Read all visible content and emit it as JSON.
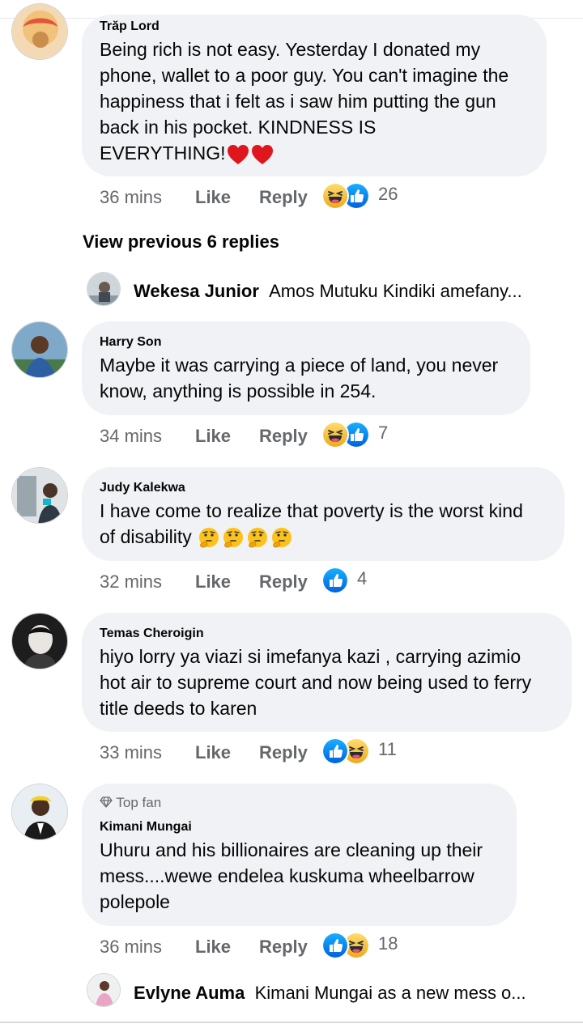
{
  "comments": [
    {
      "author": "Trăp Lord",
      "text": "Being rich is not easy. Yesterday I donated my\nphone, wallet to a poor guy. You can't imagine the\nhappiness that i felt as i saw him putting the gun\nback in his pocket. KINDNESS IS\nEVERYTHING!",
      "trailing_emoji": "❤❤",
      "time": "36 mins",
      "like_label": "Like",
      "reply_label": "Reply",
      "reactions": [
        "haha",
        "like"
      ],
      "reaction_count": "26"
    },
    {
      "author": "Harry Son",
      "text": "Maybe it was carrying a piece of land, you never\nknow, anything is possible in 254.",
      "time": "34 mins",
      "like_label": "Like",
      "reply_label": "Reply",
      "reactions": [
        "haha",
        "like"
      ],
      "reaction_count": "7"
    },
    {
      "author": "Judy Kalekwa",
      "text": "I have come to realize that poverty is the worst kind\nof disability",
      "trailing_emoji": "🤔🤔🤔🤔",
      "time": "32 mins",
      "like_label": "Like",
      "reply_label": "Reply",
      "reactions": [
        "like"
      ],
      "reaction_count": "4"
    },
    {
      "author": "Temas Cheroigin",
      "text": "hiyo lorry ya viazi si imefanya kazi , carrying azimio\nhot air to supreme court and now being used to ferry\ntitle deeds to karen",
      "time": "33 mins",
      "like_label": "Like",
      "reply_label": "Reply",
      "reactions": [
        "like",
        "haha"
      ],
      "reaction_count": "11"
    },
    {
      "badge": "Top fan",
      "author": "Kimani Mungai",
      "text": "Uhuru and his billionaires are cleaning up their\nmess....wewe endelea kuskuma wheelbarrow\npolepole",
      "time": "36 mins",
      "like_label": "Like",
      "reply_label": "Reply",
      "reactions": [
        "like",
        "haha"
      ],
      "reaction_count": "18"
    }
  ],
  "view_previous": "View previous 6 replies",
  "reply_previews": [
    {
      "author": "Wekesa Junior",
      "snippet": "Amos Mutuku Kindiki amefany..."
    },
    {
      "author": "Evlyne Auma",
      "snippet": "Kimani Mungai as a new mess o..."
    }
  ],
  "colors": {
    "bubble": "#f0f2f5",
    "meta_text": "#65676b",
    "like_blue": "#1877f2",
    "haha_yellow": "#f7b125"
  }
}
